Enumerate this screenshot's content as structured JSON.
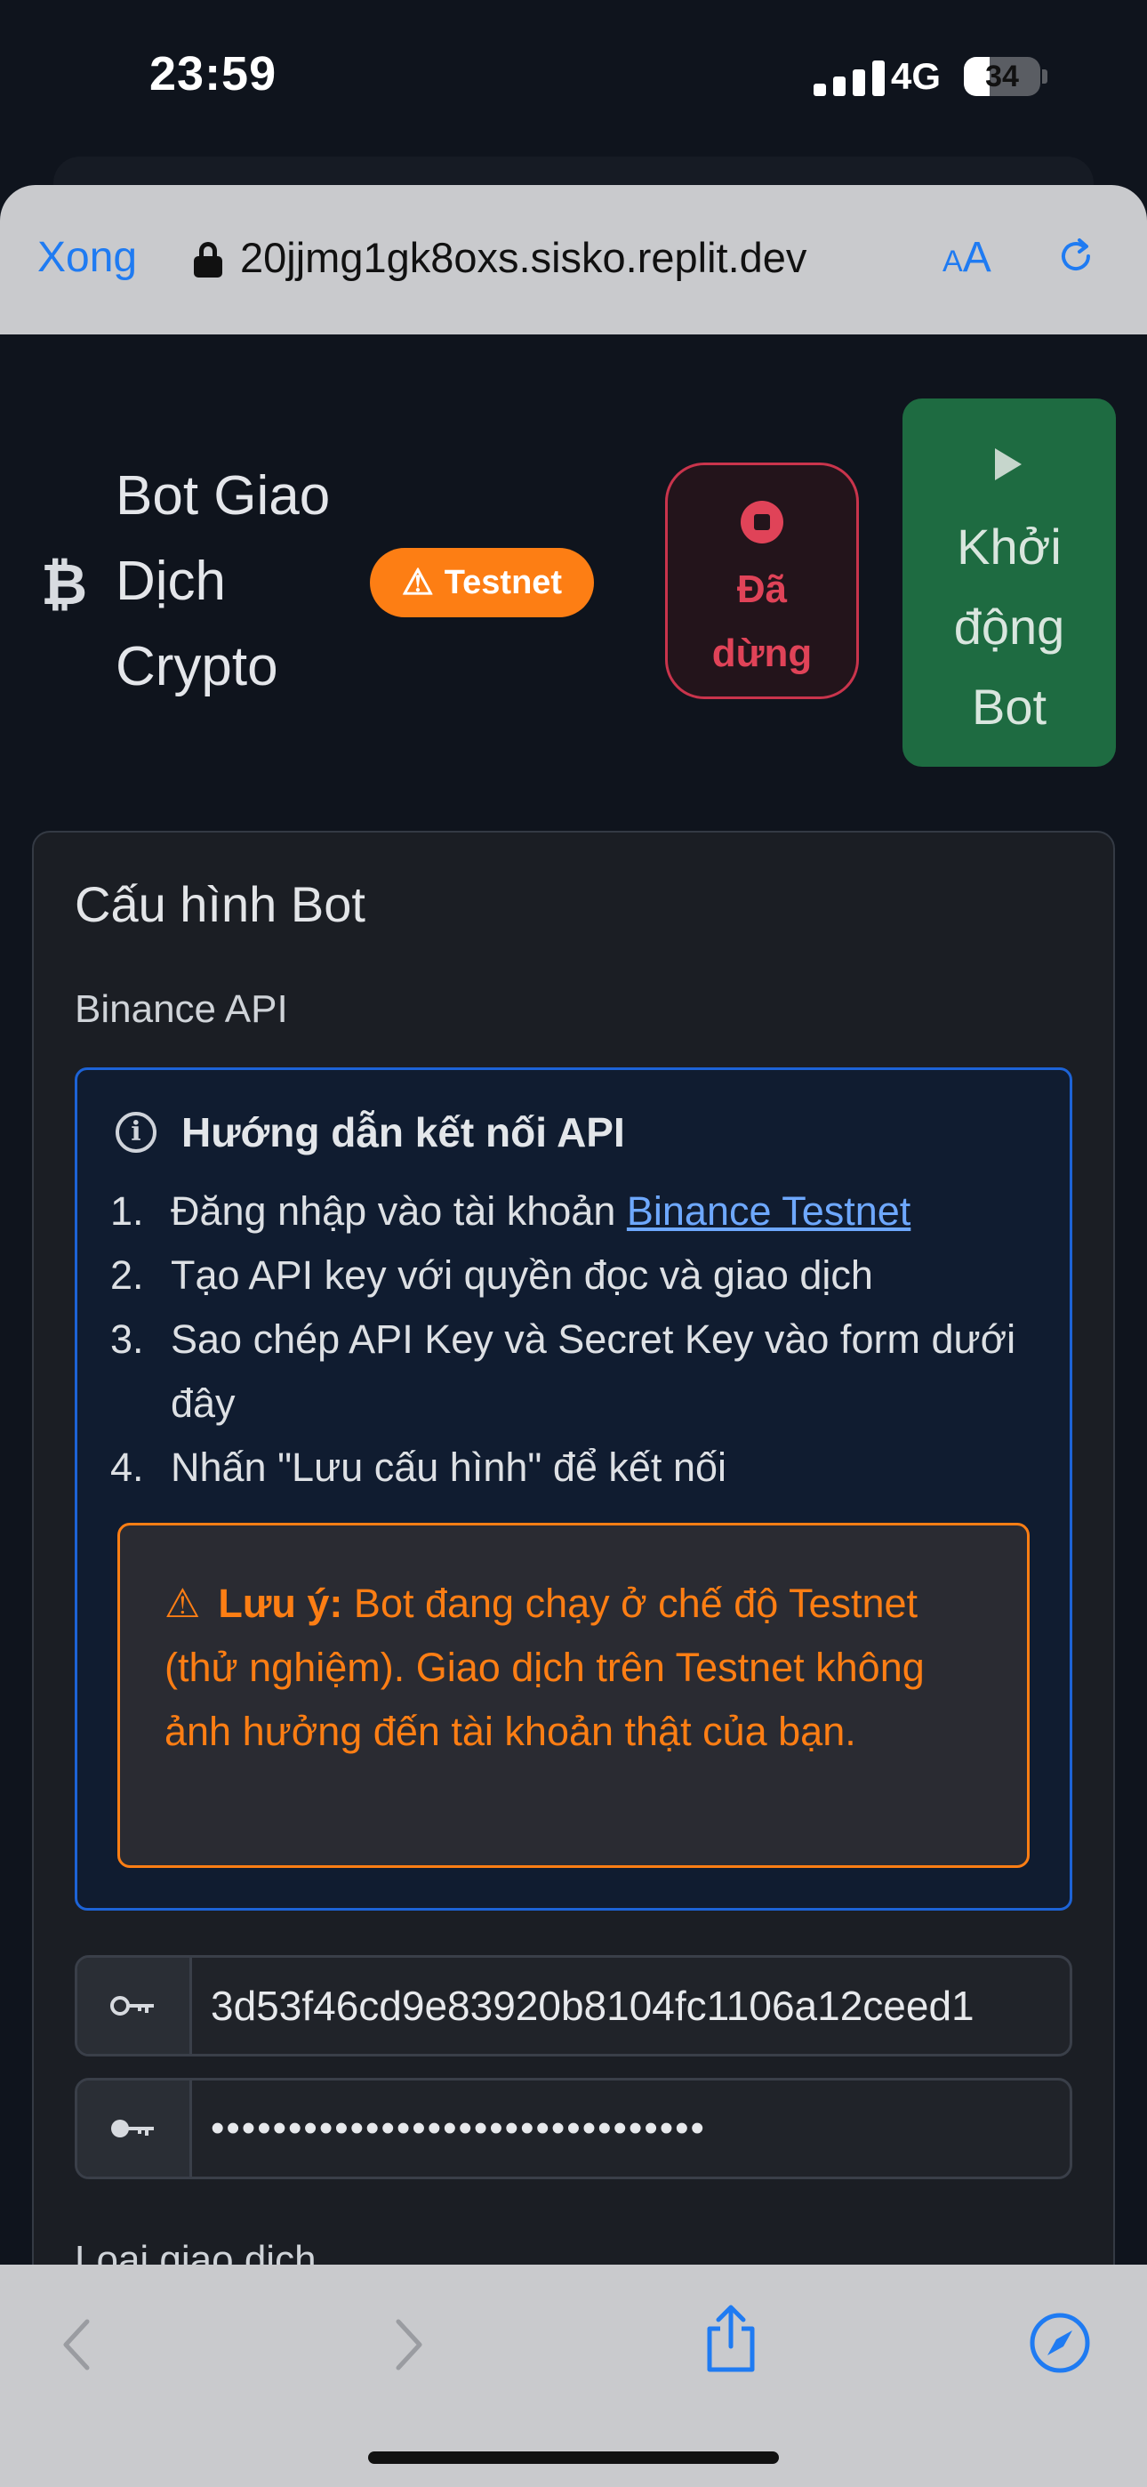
{
  "status_bar": {
    "time": "23:59",
    "network": "4G",
    "battery": "34",
    "battery_level_percent": 34
  },
  "browser": {
    "done_label": "Xong",
    "url": "20jjmg1gk8oxs.sisko.replit.dev",
    "text_size_small": "A",
    "text_size_large": "A"
  },
  "header": {
    "icon": "₿",
    "title_lines": [
      "Bot Giao",
      "Dịch",
      "Crypto"
    ],
    "badge": "Testnet",
    "status_lines": [
      "Đã",
      "dừng"
    ],
    "start_lines": [
      "Khởi",
      "động",
      "Bot"
    ]
  },
  "config": {
    "title": "Cấu hình Bot",
    "section_label": "Binance API",
    "guide": {
      "title": "Hướng dẫn kết nối API",
      "step1_number": "1.",
      "step1_text": "Đăng nhập vào tài khoản ",
      "step1_link": "Binance Testnet",
      "step2_number": "2.",
      "step2_text": "Tạo API key với quyền đọc và giao dịch",
      "step3_number": "3.",
      "step3_text": "Sao chép API Key và Secret Key vào form dưới đây",
      "step4_number": "4.",
      "step4_text": "Nhấn \"Lưu cấu hình\" để kết nối"
    },
    "warning": {
      "label": "Lưu ý:",
      "text": " Bot đang chạy ở chế độ Testnet (thử nghiệm). Giao dịch trên Testnet không ảnh hưởng đến tài khoản thật của bạn."
    },
    "api_key_value": "3d53f46cd9e83920b8104fc1106a12ceed1",
    "secret_key_value": "••••••••••••••••••••••••••••••••",
    "next_label_partial": "Loại giao dịch"
  },
  "colors": {
    "accent_blue": "#1f7bf2",
    "testnet_orange": "#fd7e14",
    "stopped_red": "#e04358",
    "start_green": "#1e6b41"
  }
}
